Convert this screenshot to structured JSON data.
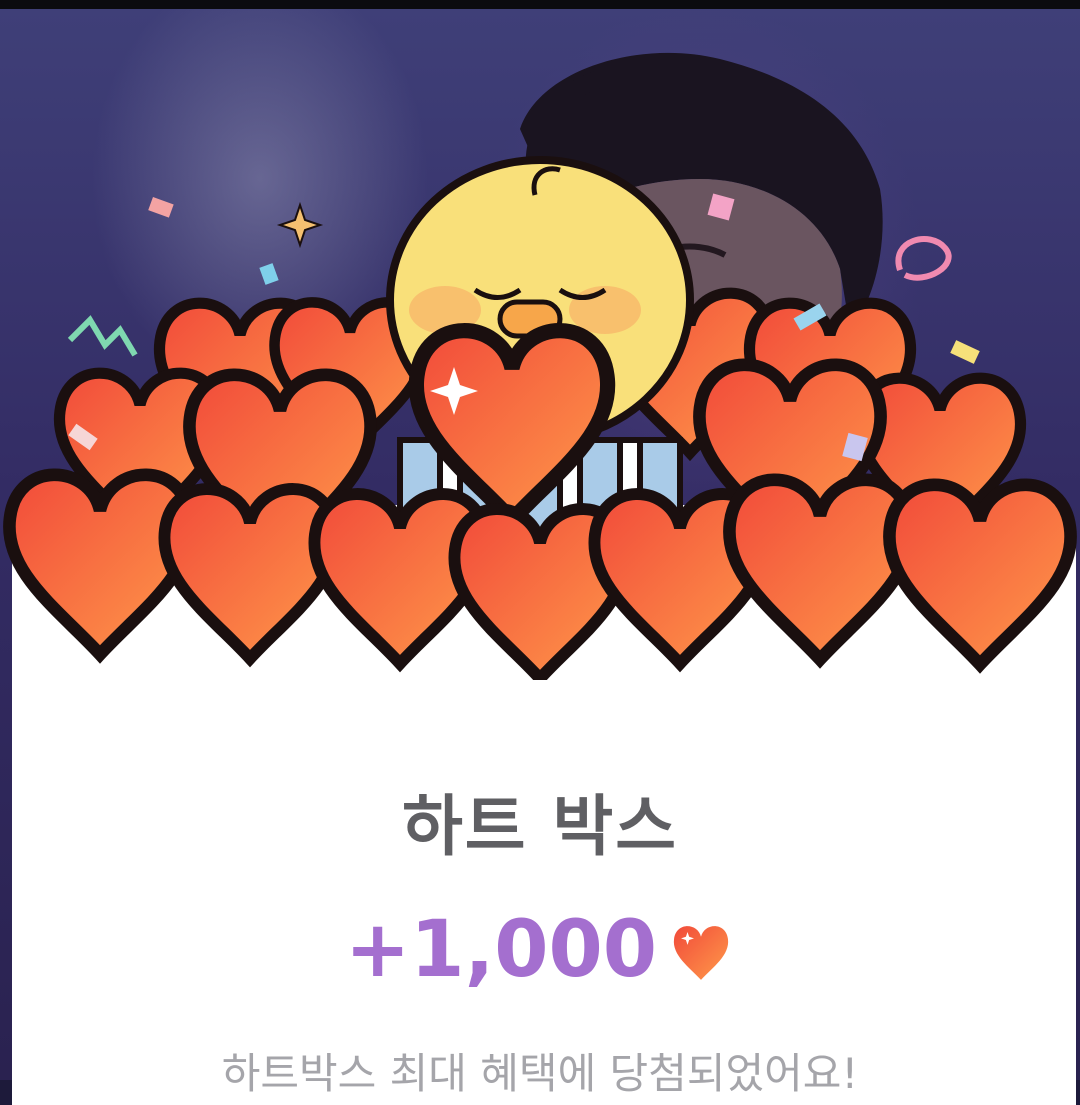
{
  "dialog": {
    "title": "하트 박스",
    "reward_amount": "+1,000",
    "reward_icon": "heart-icon",
    "description": "하트박스 최대 혜택에 당첨되었어요!"
  },
  "colors": {
    "title": "#5f5f63",
    "amount": "#a46fcf",
    "description": "#a5a5aa",
    "heart_light": "#ff9a4a",
    "heart_dark": "#f14a3a",
    "chick": "#f9e07a",
    "sheet": "#ffffff"
  }
}
